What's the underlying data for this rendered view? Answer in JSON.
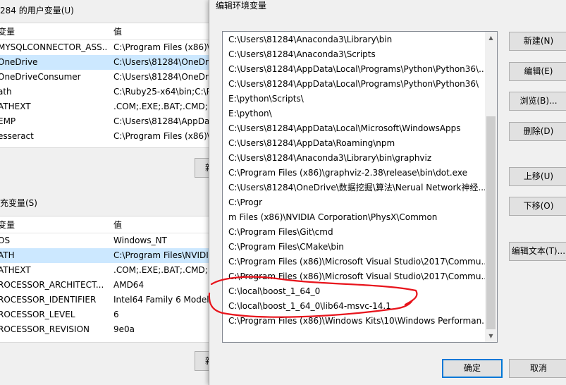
{
  "background_window": {
    "user_vars_title": "284 的用户变量(U)",
    "user_vars_header": {
      "name": "变量",
      "value": "值"
    },
    "user_vars": [
      {
        "name": "MYSQLCONNECTOR_ASS...",
        "value": "C:\\Program Files (x86)\\"
      },
      {
        "name": "OneDrive",
        "value": "C:\\Users\\81284\\OneDri"
      },
      {
        "name": "OneDriveConsumer",
        "value": "C:\\Users\\81284\\OneDri"
      },
      {
        "name": "ath",
        "value": "C:\\Ruby25-x64\\bin;C:\\P"
      },
      {
        "name": "ATHEXT",
        "value": ".COM;.EXE;.BAT;.CMD;."
      },
      {
        "name": "EMP",
        "value": "C:\\Users\\81284\\AppDat"
      },
      {
        "name": "esseract",
        "value": "C:\\Program Files (x86)\\"
      }
    ],
    "user_button_label": "新",
    "system_vars_title": "充变量(S)",
    "system_vars_header": {
      "name": "变量",
      "value": "值"
    },
    "system_vars": [
      {
        "name": "OS",
        "value": "Windows_NT"
      },
      {
        "name": "ATH",
        "value": "C:\\Program Files\\NVIDI"
      },
      {
        "name": "ATHEXT",
        "value": ".COM;.EXE;.BAT;.CMD;."
      },
      {
        "name": "ROCESSOR_ARCHITECT...",
        "value": "AMD64"
      },
      {
        "name": "ROCESSOR_IDENTIFIER",
        "value": "Intel64 Family 6 Model"
      },
      {
        "name": "ROCESSOR_LEVEL",
        "value": "6"
      },
      {
        "name": "ROCESSOR_REVISION",
        "value": "9e0a"
      }
    ],
    "system_button_label": "新"
  },
  "dialog": {
    "title": "编辑环境变量",
    "path_entries": [
      "C:\\Users\\81284\\Anaconda3\\Library\\bin",
      "C:\\Users\\81284\\Anaconda3\\Scripts",
      "C:\\Users\\81284\\AppData\\Local\\Programs\\Python\\Python36\\...",
      "C:\\Users\\81284\\AppData\\Local\\Programs\\Python\\Python36\\",
      "E:\\python\\Scripts\\",
      "E:\\python\\",
      "C:\\Users\\81284\\AppData\\Local\\Microsoft\\WindowsApps",
      "C:\\Users\\81284\\AppData\\Roaming\\npm",
      "C:\\Users\\81284\\Anaconda3\\Library\\bin\\graphviz",
      "C:\\Program Files (x86)\\graphviz-2.38\\release\\bin\\dot.exe",
      "C:\\Users\\81284\\OneDrive\\数据挖掘\\算法\\Nerual Network神经...",
      "C:\\Progr",
      "m Files (x86)\\NVIDIA Corporation\\PhysX\\Common",
      "C:\\Program Files\\Git\\cmd",
      "C:\\Program Files\\CMake\\bin",
      "C:\\Program Files (x86)\\Microsoft Visual Studio\\2017\\Commu...",
      "C:\\Program Files (x86)\\Microsoft Visual Studio\\2017\\Commu...",
      "C:\\local\\boost_1_64_0",
      "C:\\local\\boost_1_64_0\\lib64-msvc-14.1",
      "C:\\Program Files (x86)\\Windows Kits\\10\\Windows Performan..."
    ],
    "buttons": {
      "new": "新建(N)",
      "edit": "编辑(E)",
      "browse": "浏览(B)...",
      "delete": "删除(D)",
      "move_up": "上移(U)",
      "move_down": "下移(O)",
      "edit_text": "编辑文本(T)...",
      "ok": "确定",
      "cancel": "取消"
    }
  },
  "colors": {
    "annotation_red": "#e8141c",
    "selection_blue": "#cce8ff",
    "focus_blue": "#0078d7"
  }
}
